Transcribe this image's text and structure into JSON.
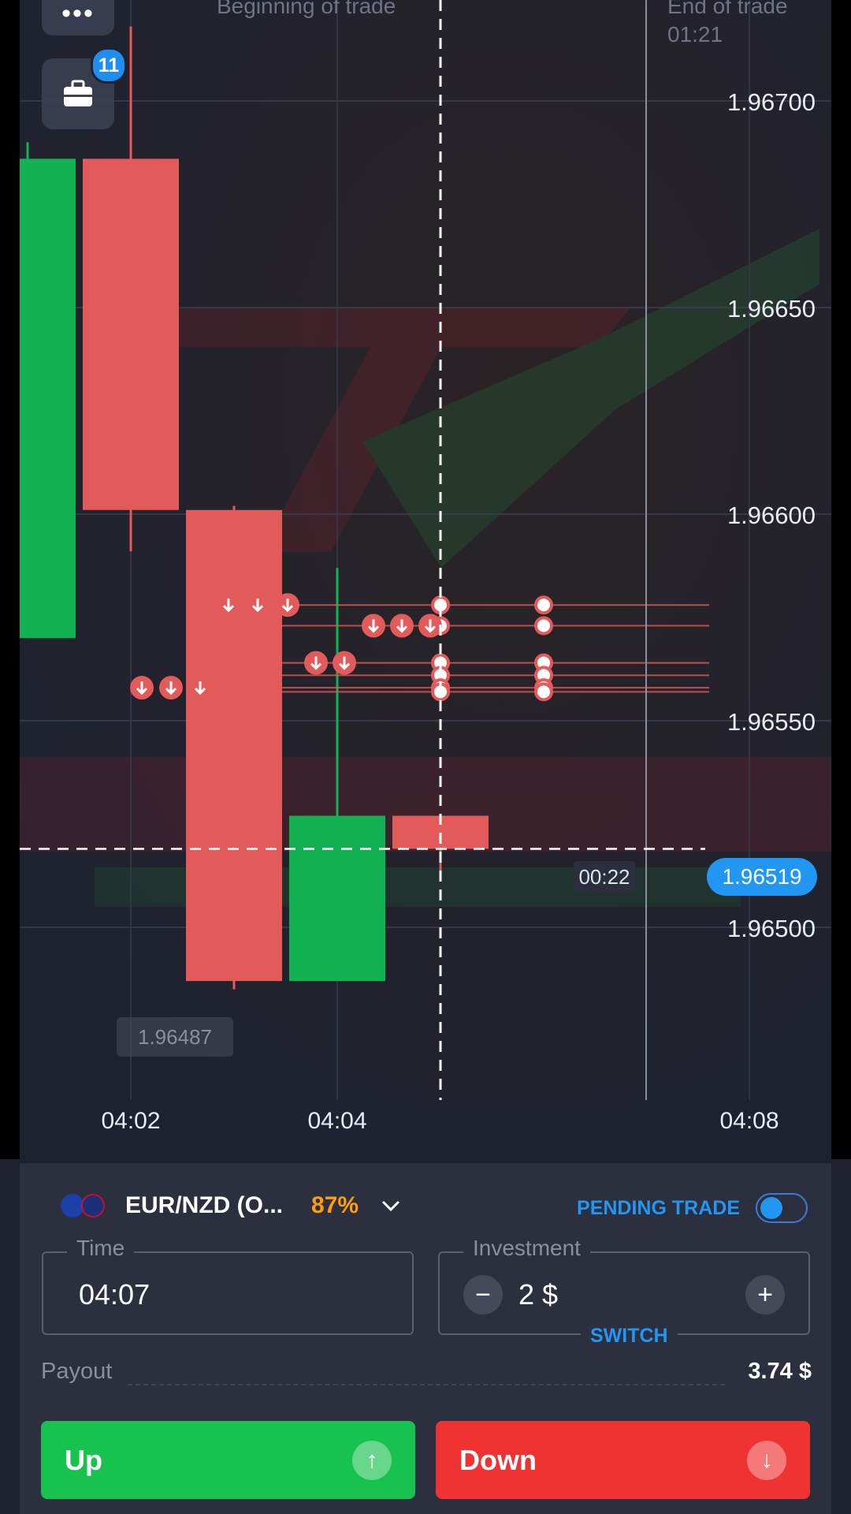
{
  "header": {
    "portfolio_badge": "11",
    "beginning_label": "Beginning of trade",
    "end_label": "End of trade",
    "end_time": "01:21"
  },
  "chart": {
    "price_labels": [
      "1.96700",
      "1.96650",
      "1.96600",
      "1.96550",
      "1.96500"
    ],
    "time_labels": [
      "04:02",
      "04:04",
      "04:08"
    ],
    "current_price": "1.96519",
    "countdown": "00:22",
    "low_marker": "1.96487"
  },
  "colors": {
    "bull": "#12b151",
    "bear": "#e35a5a",
    "accent": "#2196f3",
    "payout_pct": "#ff9d0a",
    "up_button": "#18c24f",
    "down_button": "#ef3232"
  },
  "chart_data": {
    "type": "candlestick",
    "candles": [
      {
        "time": "04:01",
        "open": 1.9657,
        "close": 1.96686,
        "high": 1.9669,
        "low": 1.9657
      },
      {
        "time": "04:02",
        "open": 1.96686,
        "close": 1.96601,
        "high": 1.96718,
        "low": 1.96591
      },
      {
        "time": "04:03",
        "open": 1.96601,
        "close": 1.96487,
        "high": 1.96602,
        "low": 1.96485
      },
      {
        "time": "04:04",
        "open": 1.96487,
        "close": 1.96527,
        "high": 1.96587,
        "low": 1.96487
      },
      {
        "time": "04:05",
        "open": 1.96527,
        "close": 1.96519,
        "high": 1.96527,
        "low": 1.96513
      }
    ],
    "trades": [
      1.96578,
      1.96573,
      1.96564,
      1.96561,
      1.96558,
      1.96557
    ],
    "ylim": [
      1.9646,
      1.96725
    ]
  },
  "panel": {
    "asset": "EUR/NZD (O...",
    "payout_pct": "87%",
    "pending_label": "PENDING TRADE",
    "time_legend": "Time",
    "time_value": "04:07",
    "investment_legend": "Investment",
    "investment_value": "2 $",
    "minus": "−",
    "plus": "+",
    "switch_label": "SWITCH",
    "payout_label": "Payout",
    "payout_value": "3.74 $",
    "up_label": "Up",
    "down_label": "Down"
  }
}
